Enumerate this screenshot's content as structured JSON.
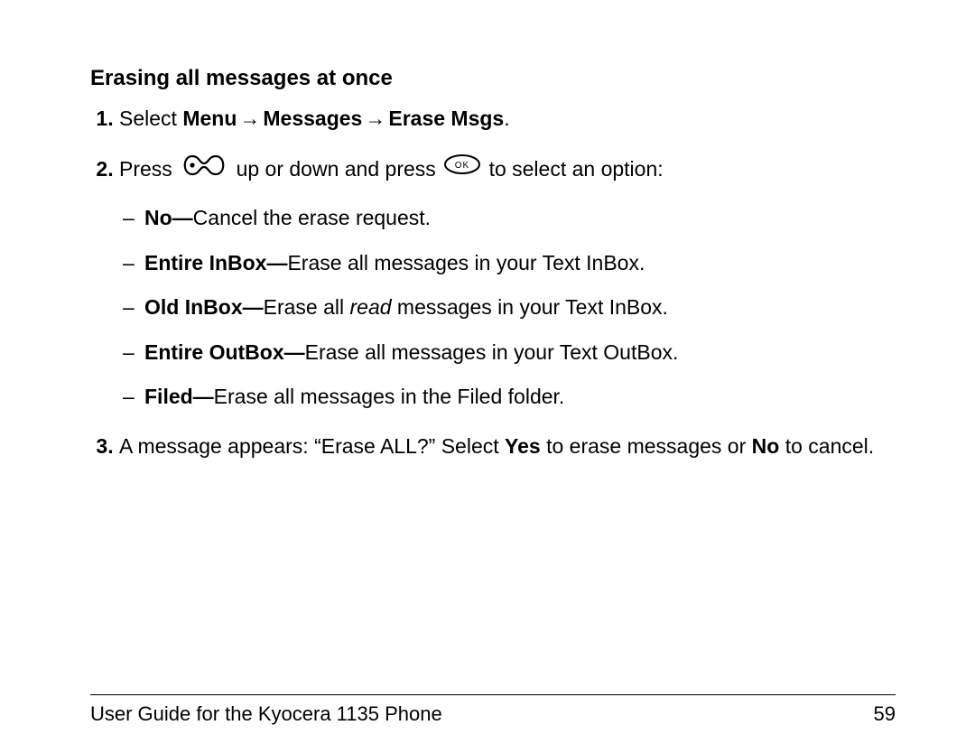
{
  "section_heading": "Erasing all messages at once",
  "steps": {
    "s1": {
      "prefix": "Select ",
      "menu": "Menu",
      "arrow": " → ",
      "messages": "Messages",
      "erase": "Erase Msgs",
      "period": "."
    },
    "s2": {
      "press": "Press ",
      "mid": " up or down and press ",
      "tail": " to select an option:",
      "nav_icon": "nav-key-icon",
      "ok_icon": "ok-key-icon",
      "options": {
        "o1_label": "No—",
        "o1_desc": "Cancel the erase request.",
        "o2_label": "Entire InBox—",
        "o2_desc": "Erase all messages in your Text InBox.",
        "o3_label": "Old InBox—",
        "o3_desc_a": "Erase all ",
        "o3_desc_i": "read",
        "o3_desc_b": " messages in your Text InBox.",
        "o4_label": "Entire OutBox—",
        "o4_desc": "Erase all messages in your Text OutBox.",
        "o5_label": "Filed—",
        "o5_desc": "Erase all messages in the Filed folder."
      }
    },
    "s3": {
      "a": "A message appears: “Erase ALL?” Select ",
      "yes": "Yes",
      "b": " to erase messages or ",
      "no": "No",
      "c": " to cancel."
    }
  },
  "footer": {
    "left": "User Guide for the Kyocera 1135 Phone",
    "right": "59"
  }
}
